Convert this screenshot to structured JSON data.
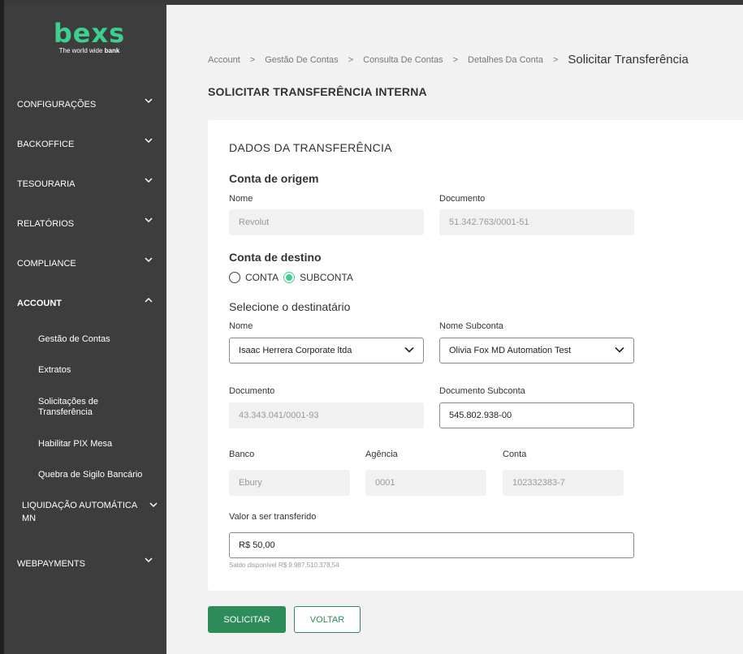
{
  "brand": {
    "logo_text": "bexs",
    "tagline_prefix": "The world wide ",
    "tagline_bold": "bank",
    "accent_color": "#3ecf8e",
    "primary_button_color": "#2e8b5a"
  },
  "sidebar": {
    "items": [
      {
        "label": "CONFIGURAÇÕES",
        "icon": "chevron-down-icon"
      },
      {
        "label": "BACKOFFICE",
        "icon": "chevron-down-icon"
      },
      {
        "label": "TESOURARIA",
        "icon": "chevron-down-icon"
      },
      {
        "label": "RELATÓRIOS",
        "icon": "chevron-down-icon"
      },
      {
        "label": "COMPLIANCE",
        "icon": "chevron-down-icon"
      },
      {
        "label": "ACCOUNT",
        "icon": "chevron-up-icon"
      },
      {
        "label": "LIQUIDAÇÃO AUTOMÁTICA MN",
        "icon": "chevron-down-icon"
      },
      {
        "label": "WEBPAYMENTS",
        "icon": "chevron-down-icon"
      }
    ],
    "account_subitems": [
      {
        "label": "Gestão de Contas"
      },
      {
        "label": "Extratos"
      },
      {
        "label": "Solicitações de Transferência"
      },
      {
        "label": "Habilitar PIX Mesa"
      },
      {
        "label": "Quebra de Sigilo Bancário"
      }
    ]
  },
  "breadcrumb": {
    "items": [
      "Account",
      "Gestão De Contas",
      "Consulta De Contas",
      "Detalhes Da Conta"
    ],
    "current": "Solicitar Transferência",
    "separator": ">"
  },
  "page": {
    "title": "SOLICITAR TRANSFERÊNCIA INTERNA"
  },
  "form": {
    "card_title": "DADOS DA TRANSFERÊNCIA",
    "origin": {
      "heading": "Conta de origem",
      "name_label": "Nome",
      "name_value": "Revolut",
      "doc_label": "Documento",
      "doc_value": "51.342.763/0001-51"
    },
    "destination": {
      "heading": "Conta de destino",
      "options": [
        "CONTA",
        "SUBCONTA"
      ],
      "selected": "SUBCONTA"
    },
    "recipient": {
      "heading": "Selecione o destinatário",
      "name_label": "Nome",
      "name_value": "Isaac Herrera Corporate ltda",
      "subaccount_name_label": "Nome Subconta",
      "subaccount_name_value": "Olivia Fox MD Automation Test",
      "doc_label": "Documento",
      "doc_value": "43.343.041/0001-93",
      "subaccount_doc_label": "Documento Subconta",
      "subaccount_doc_value": "545.802.938-00",
      "bank_label": "Banco",
      "bank_value": "Ebury",
      "agency_label": "Agência",
      "agency_value": "0001",
      "account_label": "Conta",
      "account_value": "102332383-7"
    },
    "amount": {
      "label": "Valor a ser transferido",
      "value": "R$ 50,00",
      "balance_hint": "Saldo disponível R$ 9.987.510.378,54"
    }
  },
  "actions": {
    "submit_label": "SOLICITAR",
    "back_label": "VOLTAR"
  }
}
